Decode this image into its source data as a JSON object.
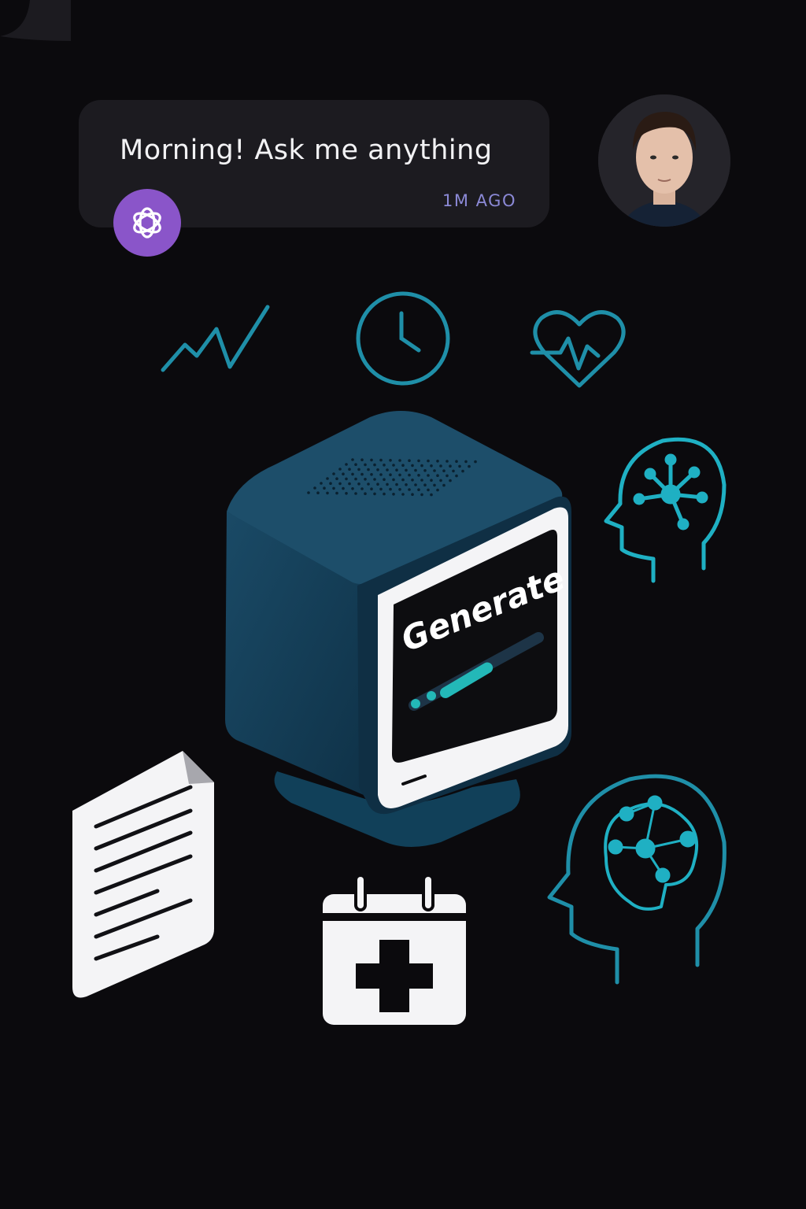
{
  "chat": {
    "message": "Morning! Ask me anything",
    "time": "1M AGO"
  },
  "device": {
    "screen_label": "Generate",
    "progress_fraction": 0.45
  },
  "icons": [
    "trend-line-icon",
    "clock-icon",
    "heart-pulse-icon",
    "head-network-icon",
    "head-brain-icon",
    "document-icon",
    "medical-calendar-icon",
    "sound-wave-icon"
  ],
  "colors": {
    "background": "#0b0a0d",
    "bubble": "#1c1b20",
    "accent_teal": "#1f8fa8",
    "accent_purple": "#8a55c9",
    "device_body": "#16405a",
    "timestamp": "#8b89d6"
  }
}
